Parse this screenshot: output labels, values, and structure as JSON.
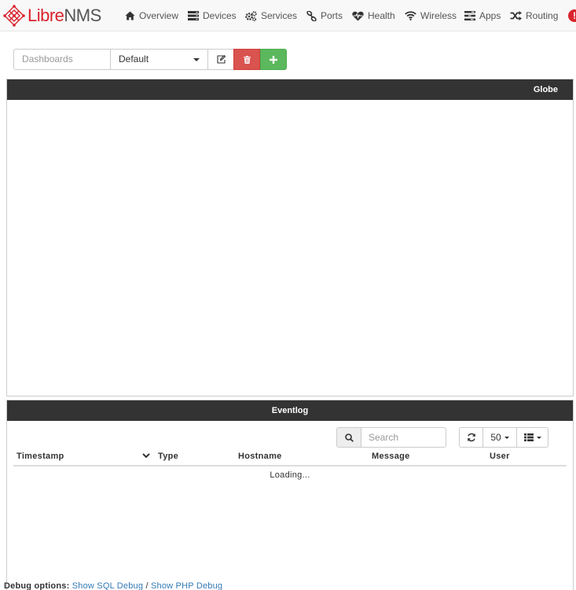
{
  "brand": {
    "libre": "Libre",
    "nms": "NMS"
  },
  "nav": [
    {
      "label": "Overview",
      "icon": "home-icon"
    },
    {
      "label": "Devices",
      "icon": "server-icon"
    },
    {
      "label": "Services",
      "icon": "cogs-icon"
    },
    {
      "label": "Ports",
      "icon": "link-icon"
    },
    {
      "label": "Health",
      "icon": "heartbeat-icon"
    },
    {
      "label": "Wireless",
      "icon": "wifi-icon"
    },
    {
      "label": "Apps",
      "icon": "tasks-icon"
    },
    {
      "label": "Routing",
      "icon": "random-icon"
    }
  ],
  "dashboard": {
    "placeholder": "Dashboards",
    "selected": "Default"
  },
  "panels": {
    "globe_title": "Globe",
    "eventlog_title": "Eventlog"
  },
  "eventlog": {
    "search_placeholder": "Search",
    "row_count": "50",
    "columns": [
      "Timestamp",
      "Type",
      "Hostname",
      "Message",
      "User"
    ],
    "loading": "Loading..."
  },
  "debug": {
    "label": "Debug options:",
    "sql": "Show SQL Debug",
    "separator": "/",
    "php": "Show PHP Debug"
  },
  "colors": {
    "brand_red": "#d9232d",
    "panel_header": "#333333",
    "danger": "#d9534f",
    "success": "#5cb85c",
    "link": "#337ab7"
  }
}
